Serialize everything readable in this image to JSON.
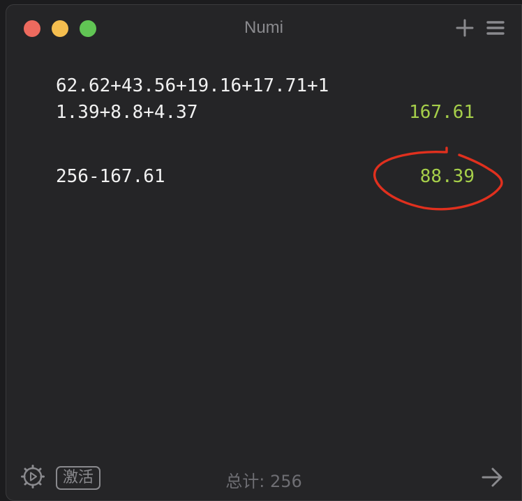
{
  "window": {
    "title": "Numi"
  },
  "toolbar": {
    "add_icon": "plus-icon",
    "menu_icon": "hamburger-menu-icon"
  },
  "editor": {
    "lines": [
      {
        "expression": "62.62+43.56+19.16+17.71+1",
        "result": ""
      },
      {
        "expression": "1.39+8.8+4.37",
        "result": "167.61"
      },
      {
        "expression": "",
        "result": ""
      },
      {
        "expression": "256-167.61",
        "result": "88.39"
      }
    ],
    "annotation": {
      "color": "#e0301e",
      "shape": "hand-drawn-circle",
      "target": "88.39"
    }
  },
  "footer": {
    "settings_icon": "gear-icon",
    "activate_label": "激活",
    "total_text": "总计: 256",
    "arrow_icon": "arrow-right-icon"
  },
  "colors": {
    "background": "#252527",
    "text": "#f2f2f2",
    "result": "#a6cf4a",
    "muted": "#8a8a8e",
    "close": "#ed6a5e",
    "minimize": "#f5be4f",
    "maximize": "#61c554"
  }
}
